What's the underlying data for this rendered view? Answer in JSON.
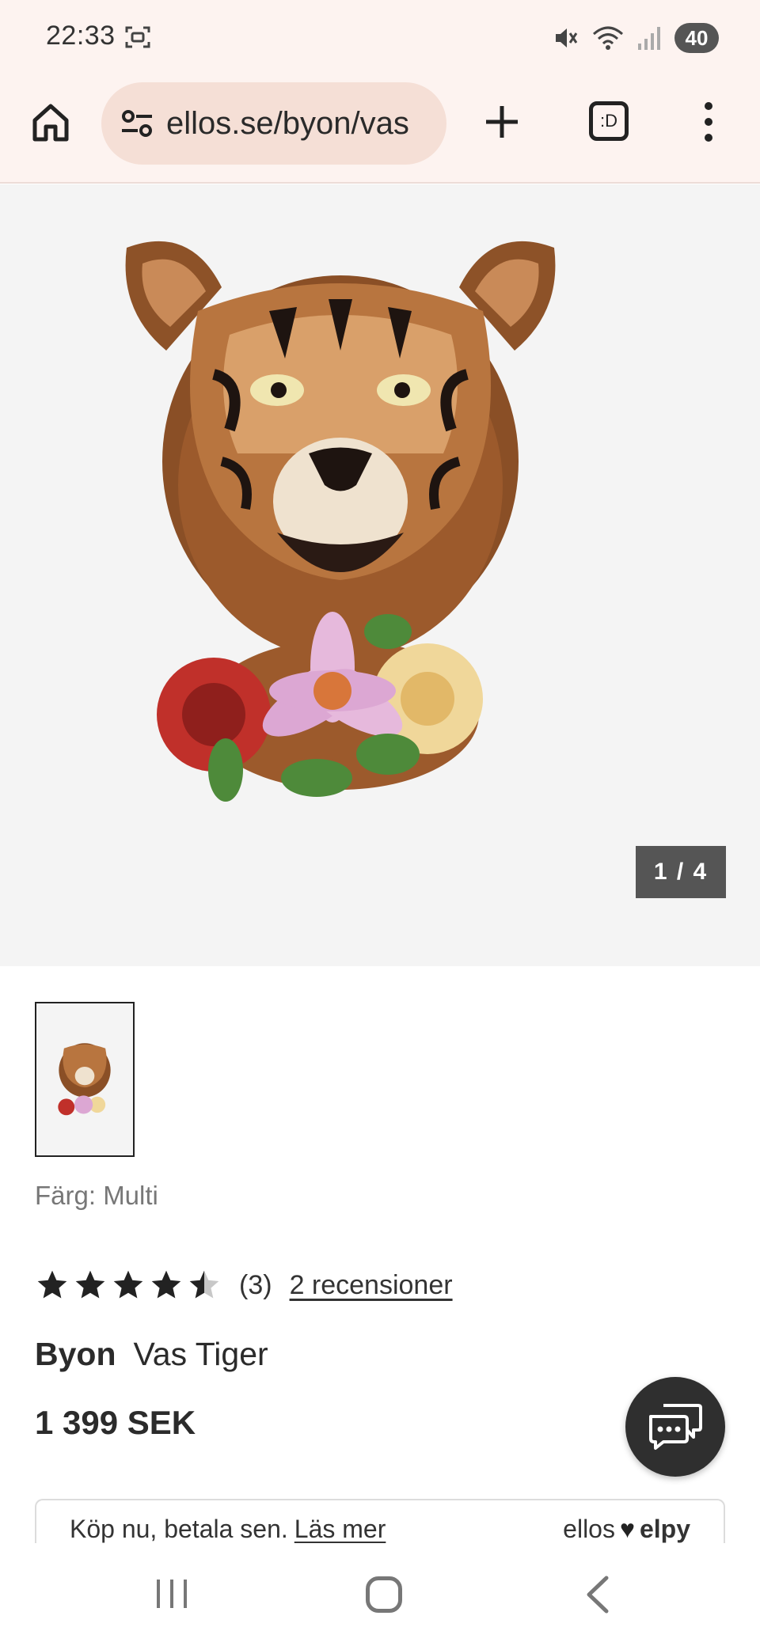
{
  "status_bar": {
    "time": "22:33",
    "battery": "40",
    "icons": [
      "screenshot-icon",
      "mute-icon",
      "wifi-icon",
      "signal-icon",
      "battery-icon"
    ]
  },
  "browser": {
    "url": "ellos.se/byon/vas",
    "tab_label": ":D",
    "icons": [
      "home-icon",
      "site-settings-icon",
      "plus-icon",
      "tabs-icon",
      "more-vert-icon"
    ]
  },
  "gallery": {
    "counter": "1 / 4"
  },
  "product": {
    "color_label": "Färg: Multi",
    "rating": 4.5,
    "rating_count": "(3)",
    "reviews_link": "2 recensioner",
    "brand": "Byon",
    "name": "Vas Tiger",
    "price": "1 399 SEK"
  },
  "payment": {
    "text": "Köp nu, betala sen.",
    "link": "Läs mer",
    "logo_left": "ellos",
    "logo_right": "elpy"
  },
  "colors": {
    "background": "#ffffff",
    "chrome": "#fdf3f0",
    "url_pill": "#f5dfd6",
    "counter_bg": "#555555",
    "chat_bg": "#2f2f2f"
  }
}
